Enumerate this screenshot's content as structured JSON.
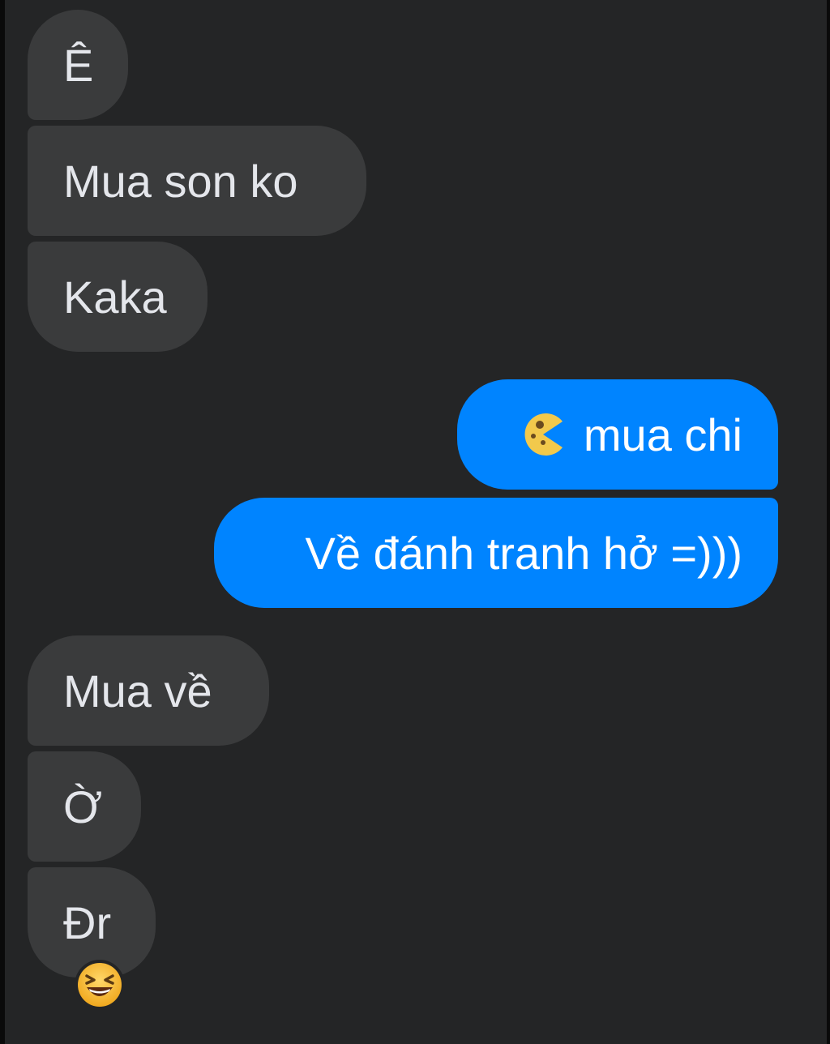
{
  "messages": [
    {
      "id": "m1",
      "side": "incoming",
      "text": "Ê"
    },
    {
      "id": "m2",
      "side": "incoming",
      "text": "Mua son ko"
    },
    {
      "id": "m3",
      "side": "incoming",
      "text": "Kaka"
    },
    {
      "id": "m4",
      "side": "outgoing",
      "text": "mua chi",
      "emoji": "pacman-face-emoji"
    },
    {
      "id": "m5",
      "side": "outgoing",
      "text": "Về đánh tranh hở =)))"
    },
    {
      "id": "m6",
      "side": "incoming",
      "text": "Mua về"
    },
    {
      "id": "m7",
      "side": "incoming",
      "text": "Ờ"
    },
    {
      "id": "m8",
      "side": "incoming",
      "text": "Đr",
      "reaction": "grinning-squinting-face-emoji"
    }
  ],
  "colors": {
    "background": "#242526",
    "incoming_bubble": "#3a3b3c",
    "outgoing_bubble": "#0084ff",
    "incoming_text": "#e4e6eb",
    "outgoing_text": "#ffffff"
  }
}
